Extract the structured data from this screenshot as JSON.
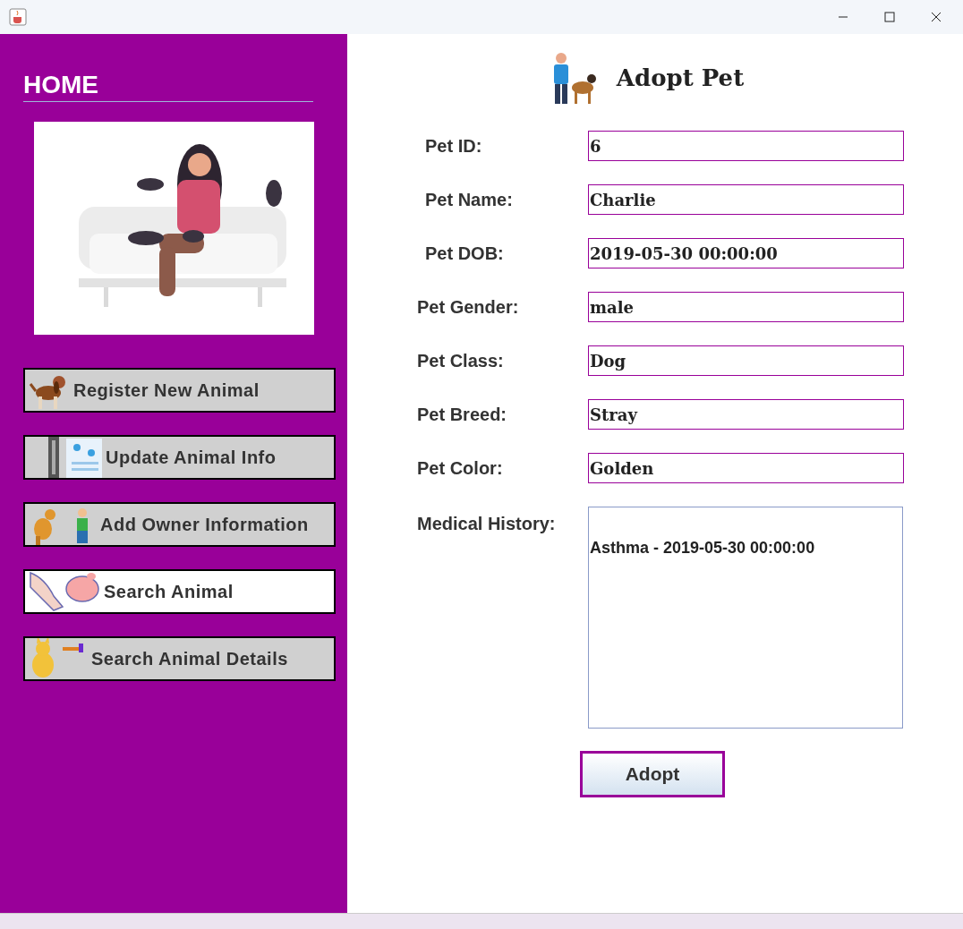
{
  "sidebar": {
    "title": "HOME",
    "buttons": [
      {
        "label": "Register New Animal",
        "selected": false
      },
      {
        "label": "Update Animal Info",
        "selected": false
      },
      {
        "label": "Add Owner Information",
        "selected": false
      },
      {
        "label": "Search Animal",
        "selected": true
      },
      {
        "label": "Search Animal Details",
        "selected": false
      }
    ]
  },
  "form": {
    "title": "Adopt Pet",
    "fields": [
      {
        "label": "Pet ID:",
        "value": "6"
      },
      {
        "label": "Pet Name:",
        "value": "Charlie"
      },
      {
        "label": "Pet DOB:",
        "value": "2019-05-30 00:00:00"
      },
      {
        "label": "Pet Gender:",
        "value": "male"
      },
      {
        "label": "Pet Class:",
        "value": "Dog"
      },
      {
        "label": "Pet Breed:",
        "value": "Stray"
      },
      {
        "label": "Pet Color:",
        "value": "Golden"
      }
    ],
    "medical_history": {
      "label": "Medical History:",
      "value": "Asthma - 2019-05-30 00:00:00"
    },
    "button": "Adopt"
  }
}
